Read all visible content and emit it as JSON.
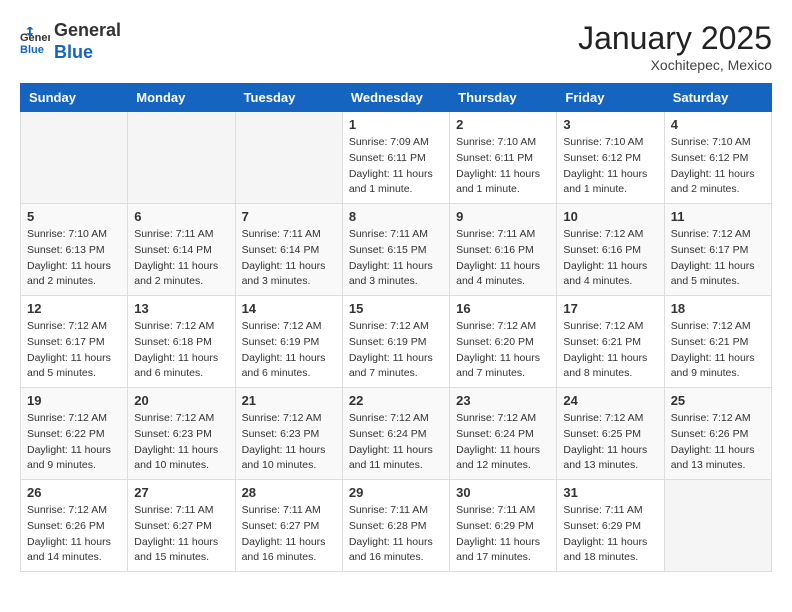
{
  "header": {
    "logo_general": "General",
    "logo_blue": "Blue",
    "month_title": "January 2025",
    "subtitle": "Xochitepec, Mexico"
  },
  "days_of_week": [
    "Sunday",
    "Monday",
    "Tuesday",
    "Wednesday",
    "Thursday",
    "Friday",
    "Saturday"
  ],
  "weeks": [
    [
      {
        "day": "",
        "info": ""
      },
      {
        "day": "",
        "info": ""
      },
      {
        "day": "",
        "info": ""
      },
      {
        "day": "1",
        "info": "Sunrise: 7:09 AM\nSunset: 6:11 PM\nDaylight: 11 hours and 1 minute."
      },
      {
        "day": "2",
        "info": "Sunrise: 7:10 AM\nSunset: 6:11 PM\nDaylight: 11 hours and 1 minute."
      },
      {
        "day": "3",
        "info": "Sunrise: 7:10 AM\nSunset: 6:12 PM\nDaylight: 11 hours and 1 minute."
      },
      {
        "day": "4",
        "info": "Sunrise: 7:10 AM\nSunset: 6:12 PM\nDaylight: 11 hours and 2 minutes."
      }
    ],
    [
      {
        "day": "5",
        "info": "Sunrise: 7:10 AM\nSunset: 6:13 PM\nDaylight: 11 hours and 2 minutes."
      },
      {
        "day": "6",
        "info": "Sunrise: 7:11 AM\nSunset: 6:14 PM\nDaylight: 11 hours and 2 minutes."
      },
      {
        "day": "7",
        "info": "Sunrise: 7:11 AM\nSunset: 6:14 PM\nDaylight: 11 hours and 3 minutes."
      },
      {
        "day": "8",
        "info": "Sunrise: 7:11 AM\nSunset: 6:15 PM\nDaylight: 11 hours and 3 minutes."
      },
      {
        "day": "9",
        "info": "Sunrise: 7:11 AM\nSunset: 6:16 PM\nDaylight: 11 hours and 4 minutes."
      },
      {
        "day": "10",
        "info": "Sunrise: 7:12 AM\nSunset: 6:16 PM\nDaylight: 11 hours and 4 minutes."
      },
      {
        "day": "11",
        "info": "Sunrise: 7:12 AM\nSunset: 6:17 PM\nDaylight: 11 hours and 5 minutes."
      }
    ],
    [
      {
        "day": "12",
        "info": "Sunrise: 7:12 AM\nSunset: 6:17 PM\nDaylight: 11 hours and 5 minutes."
      },
      {
        "day": "13",
        "info": "Sunrise: 7:12 AM\nSunset: 6:18 PM\nDaylight: 11 hours and 6 minutes."
      },
      {
        "day": "14",
        "info": "Sunrise: 7:12 AM\nSunset: 6:19 PM\nDaylight: 11 hours and 6 minutes."
      },
      {
        "day": "15",
        "info": "Sunrise: 7:12 AM\nSunset: 6:19 PM\nDaylight: 11 hours and 7 minutes."
      },
      {
        "day": "16",
        "info": "Sunrise: 7:12 AM\nSunset: 6:20 PM\nDaylight: 11 hours and 7 minutes."
      },
      {
        "day": "17",
        "info": "Sunrise: 7:12 AM\nSunset: 6:21 PM\nDaylight: 11 hours and 8 minutes."
      },
      {
        "day": "18",
        "info": "Sunrise: 7:12 AM\nSunset: 6:21 PM\nDaylight: 11 hours and 9 minutes."
      }
    ],
    [
      {
        "day": "19",
        "info": "Sunrise: 7:12 AM\nSunset: 6:22 PM\nDaylight: 11 hours and 9 minutes."
      },
      {
        "day": "20",
        "info": "Sunrise: 7:12 AM\nSunset: 6:23 PM\nDaylight: 11 hours and 10 minutes."
      },
      {
        "day": "21",
        "info": "Sunrise: 7:12 AM\nSunset: 6:23 PM\nDaylight: 11 hours and 10 minutes."
      },
      {
        "day": "22",
        "info": "Sunrise: 7:12 AM\nSunset: 6:24 PM\nDaylight: 11 hours and 11 minutes."
      },
      {
        "day": "23",
        "info": "Sunrise: 7:12 AM\nSunset: 6:24 PM\nDaylight: 11 hours and 12 minutes."
      },
      {
        "day": "24",
        "info": "Sunrise: 7:12 AM\nSunset: 6:25 PM\nDaylight: 11 hours and 13 minutes."
      },
      {
        "day": "25",
        "info": "Sunrise: 7:12 AM\nSunset: 6:26 PM\nDaylight: 11 hours and 13 minutes."
      }
    ],
    [
      {
        "day": "26",
        "info": "Sunrise: 7:12 AM\nSunset: 6:26 PM\nDaylight: 11 hours and 14 minutes."
      },
      {
        "day": "27",
        "info": "Sunrise: 7:11 AM\nSunset: 6:27 PM\nDaylight: 11 hours and 15 minutes."
      },
      {
        "day": "28",
        "info": "Sunrise: 7:11 AM\nSunset: 6:27 PM\nDaylight: 11 hours and 16 minutes."
      },
      {
        "day": "29",
        "info": "Sunrise: 7:11 AM\nSunset: 6:28 PM\nDaylight: 11 hours and 16 minutes."
      },
      {
        "day": "30",
        "info": "Sunrise: 7:11 AM\nSunset: 6:29 PM\nDaylight: 11 hours and 17 minutes."
      },
      {
        "day": "31",
        "info": "Sunrise: 7:11 AM\nSunset: 6:29 PM\nDaylight: 11 hours and 18 minutes."
      },
      {
        "day": "",
        "info": ""
      }
    ]
  ]
}
